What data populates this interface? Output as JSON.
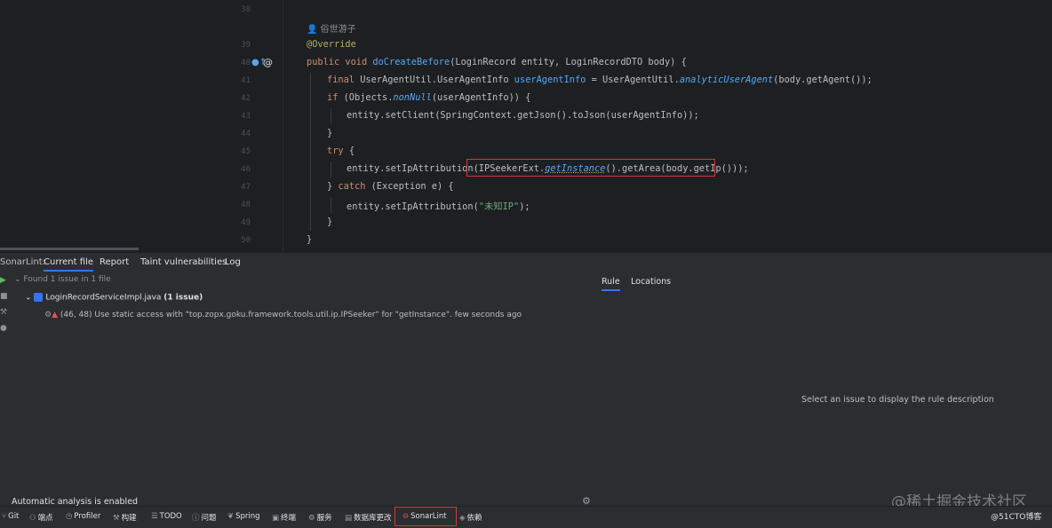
{
  "editor": {
    "line_numbers": [
      "38",
      "39",
      "40",
      "41",
      "42",
      "43",
      "44",
      "45",
      "46",
      "47",
      "48",
      "49",
      "50"
    ],
    "author": "俗世游子",
    "lines": {
      "l39": "@Override",
      "l40_kw": "public void ",
      "l40_fn": "doCreateBefore",
      "l40_rest": "(LoginRecord entity, LoginRecordDTO body) {",
      "l41_kw": "final ",
      "l41_a": "UserAgentUtil.UserAgentInfo ",
      "l41_var": "userAgentInfo",
      "l41_b": " = UserAgentUtil.",
      "l41_it": "analyticUserAgent",
      "l41_c": "(body.getAgent());",
      "l42_kw": "if ",
      "l42_a": "(Objects.",
      "l42_it": "nonNull",
      "l42_b": "(userAgentInfo)) {",
      "l43": "entity.setClient(SpringContext.getJson().toJson(userAgentInfo));",
      "l44": "}",
      "l45_kw": "try ",
      "l45_b": "{",
      "l46_a": "entity.setIpAttribution(",
      "l46_b": "IPSeekerExt.",
      "l46_it": "getInstance",
      "l46_c": "().getArea(body.getIp()));",
      "l47_a": "} ",
      "l47_kw": "catch ",
      "l47_b": "(Exception e) {",
      "l48_a": "entity.setIpAttribution(",
      "l48_str": "\"未知IP\"",
      "l48_b": ");",
      "l49": "}",
      "l50": "}"
    },
    "gutter_icons": {
      "override": "override-icon",
      "at": "@"
    }
  },
  "panel": {
    "title": "SonarLint:",
    "tabs": [
      "Current file",
      "Report",
      "Taint vulnerabilities",
      "Log"
    ],
    "found": "Found 1 issue in 1 file",
    "file": {
      "name": "LoginRecordServiceImpl.java",
      "count": "(1 issue)"
    },
    "issue": "(46, 48) Use static access with \"top.zopx.goku.framework.tools.util.ip.IPSeeker\" for \"getInstance\". few seconds ago",
    "right_tabs": [
      "Rule",
      "Locations"
    ],
    "rule_message": "Select an issue to display the rule description",
    "auto_analysis": "Automatic analysis is enabled"
  },
  "statusbar": {
    "items": [
      "Git",
      "端点",
      "Profiler",
      "构建",
      "TODO",
      "问题",
      "Spring",
      "终端",
      "服务",
      "数据库更改",
      "SonarLint",
      "依赖"
    ]
  },
  "watermark": "@稀土掘金技术社区",
  "copyright": "@51CTO博客",
  "colors": {
    "accent": "#3574f0",
    "highlight_box": "#d03c3c"
  }
}
